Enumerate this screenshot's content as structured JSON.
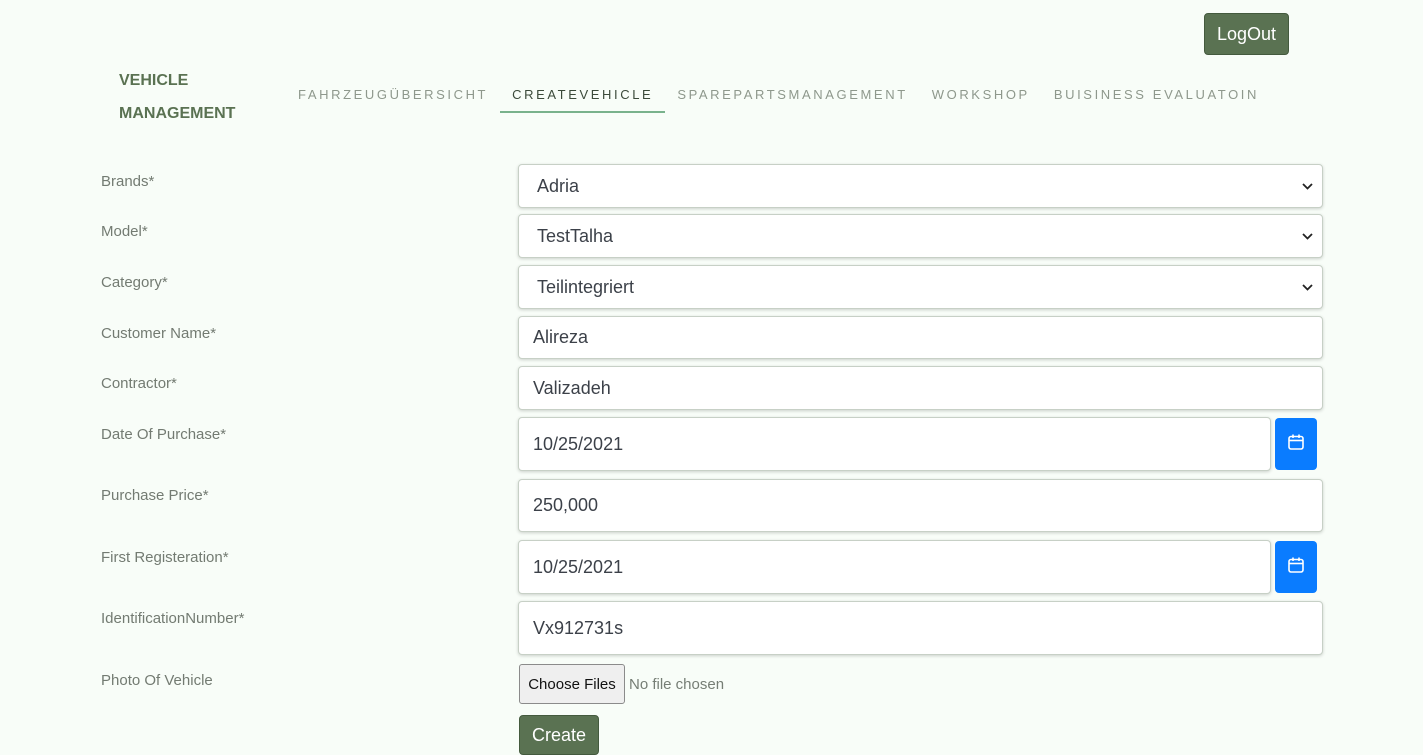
{
  "header": {
    "logout_label": "LogOut",
    "brand_line1": "VEHICLE",
    "brand_line2": "MANAGEMENT"
  },
  "nav": {
    "items": [
      {
        "label": "FAHRZEUGÜBERSICHT",
        "active": false
      },
      {
        "label": "CREATEVEHICLE",
        "active": true
      },
      {
        "label": "SPAREPARTSMANAGEMENT",
        "active": false
      },
      {
        "label": "WORKSHOP",
        "active": false
      },
      {
        "label": "BUISINESS EVALUATOIN",
        "active": false
      }
    ]
  },
  "form": {
    "brands": {
      "label": "Brands*",
      "value": "Adria"
    },
    "model": {
      "label": "Model*",
      "value": "TestTalha"
    },
    "category": {
      "label": "Category*",
      "value": "Teilintegriert"
    },
    "customer_name": {
      "label": "Customer Name*",
      "value": "Alireza"
    },
    "contractor": {
      "label": "Contractor*",
      "value": "Valizadeh"
    },
    "date_of_purchase": {
      "label": "Date Of Purchase*",
      "value": "10/25/2021"
    },
    "purchase_price": {
      "label": "Purchase Price*",
      "value": "250,000"
    },
    "first_registration": {
      "label": "First Registeration*",
      "value": "10/25/2021"
    },
    "identification_number": {
      "label": "IdentificationNumber*",
      "value": "Vx912731s"
    },
    "photo": {
      "label": "Photo Of Vehicle",
      "button_label": "Choose Files",
      "status": "No file chosen"
    },
    "create_label": "Create"
  },
  "colors": {
    "accent": "#5a7252",
    "calendar_button": "#0a7cff",
    "nav_underline": "#79b28c"
  },
  "icons": {
    "calendar": "calendar-icon",
    "dropdown": "chevron-down-icon"
  }
}
